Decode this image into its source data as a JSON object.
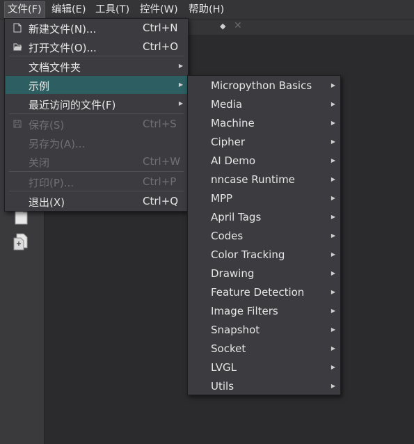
{
  "menubar": {
    "items": [
      "文件(F)",
      "编辑(E)",
      "工具(T)",
      "控件(W)",
      "帮助(H)"
    ]
  },
  "file_menu": {
    "items": [
      {
        "label": "新建文件(N)...",
        "shortcut": "Ctrl+N"
      },
      {
        "label": "打开文件(O)...",
        "shortcut": "Ctrl+O"
      },
      {
        "label": "文档文件夹"
      },
      {
        "label": "示例"
      },
      {
        "label": "最近访问的文件(F)"
      },
      {
        "label": "保存(S)",
        "shortcut": "Ctrl+S"
      },
      {
        "label": "另存为(A)..."
      },
      {
        "label": "关闭",
        "shortcut": "Ctrl+W"
      },
      {
        "label": "打印(P)...",
        "shortcut": "Ctrl+P"
      },
      {
        "label": "退出(X)",
        "shortcut": "Ctrl+Q"
      }
    ]
  },
  "examples_menu": {
    "items": [
      "Micropython Basics",
      "Media",
      "Machine",
      "Cipher",
      "AI Demo",
      "nncase Runtime",
      "MPP",
      "April Tags",
      "Codes",
      "Color Tracking",
      "Drawing",
      "Feature Detection",
      "Image Filters",
      "Snapshot",
      "Socket",
      "LVGL",
      "Utils"
    ]
  },
  "colors": {
    "highlight": "#2d5e61",
    "menu_bg": "#3c3c40",
    "disabled_text": "#707074"
  }
}
